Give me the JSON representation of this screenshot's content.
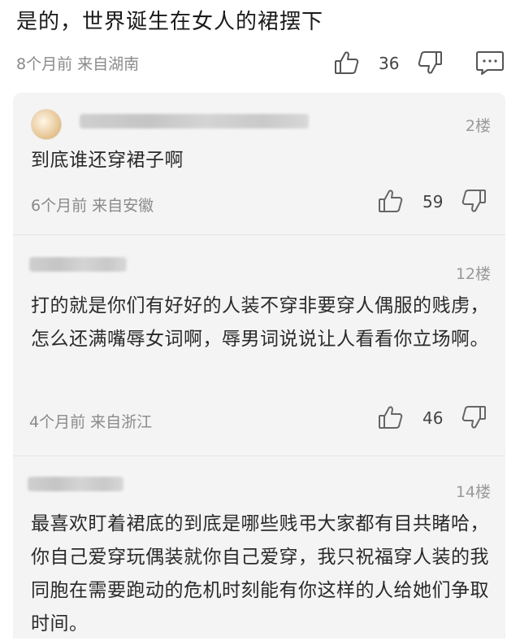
{
  "top_comment": {
    "text": "是的，世界诞生在女人的裙摆下",
    "meta": "8个月前  来自湖南",
    "likes": "36"
  },
  "replies": [
    {
      "floor": "2楼",
      "text": "到底谁还穿裙子啊",
      "meta": "6个月前  来自安徽",
      "likes": "59"
    },
    {
      "floor": "12楼",
      "text": "打的就是你们有好好的人装不穿非要穿人偶服的贱虏，怎么还满嘴辱女词啊，辱男词说说让人看看你立场啊。",
      "meta": "4个月前  来自浙江",
      "likes": "46"
    },
    {
      "floor": "14楼",
      "text": "最喜欢盯着裙底的到底是哪些贱弔大家都有目共睹哈，你自己爱穿玩偶装就你自己爱穿，我只祝福穿人装的我同胞在需要跑动的危机时刻能有你这样的人给她们争取时间。"
    }
  ],
  "icons": {
    "like": "thumbs-up-icon",
    "dislike": "thumbs-down-icon",
    "reply": "comment-bubble-icon"
  },
  "colors": {
    "text": "#2a2a2a",
    "meta": "#8a8a8a",
    "panel": "#f4f4f4"
  }
}
